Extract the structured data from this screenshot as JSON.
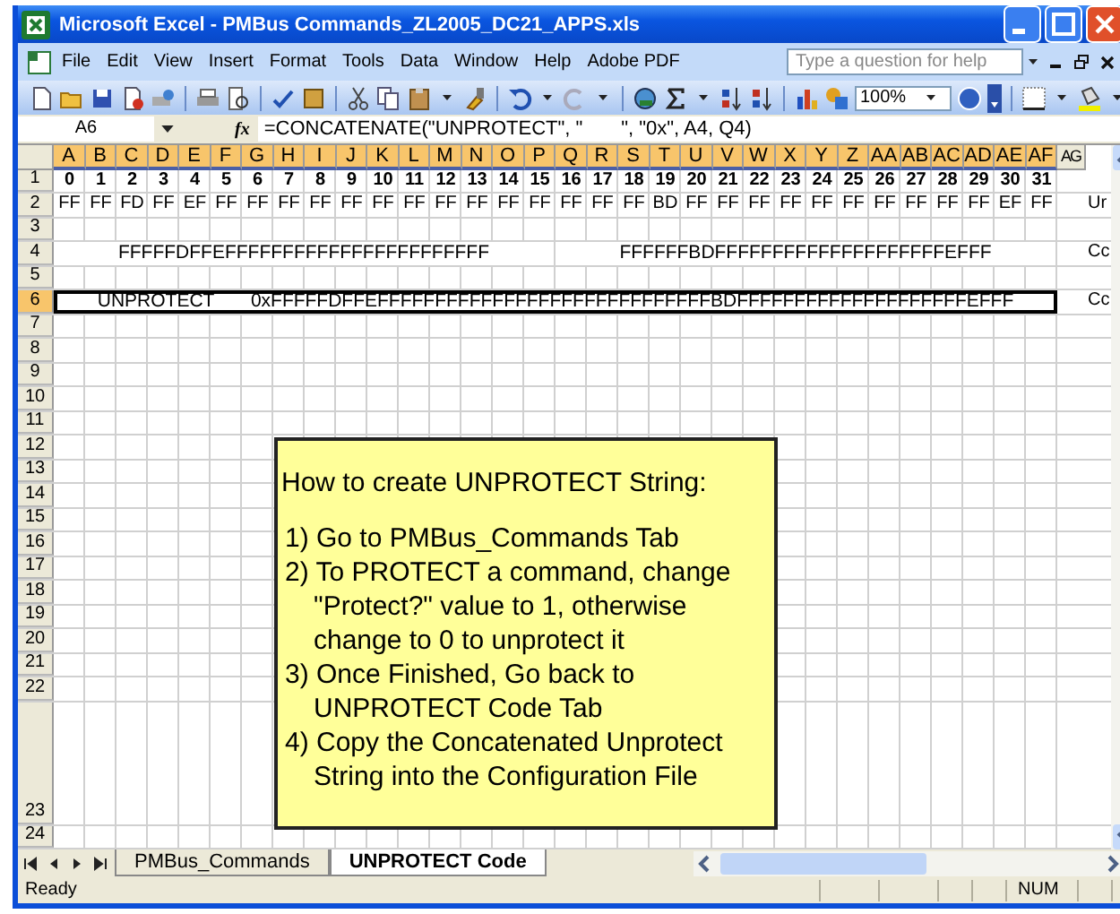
{
  "window": {
    "title": "Microsoft Excel - PMBus Commands_ZL2005_DC21_APPS.xls"
  },
  "menu": [
    "File",
    "Edit",
    "View",
    "Insert",
    "Format",
    "Tools",
    "Data",
    "Window",
    "Help",
    "Adobe PDF"
  ],
  "help_box": {
    "placeholder": "Type a question for help"
  },
  "toolbar": {
    "zoom": "100%"
  },
  "formula_bar": {
    "name_box": "A6",
    "fx": "fx",
    "formula": "=CONCATENATE(\"UNPROTECT\", \"       \", \"0x\", A4, Q4)"
  },
  "columns": [
    {
      "label": "A",
      "selected": true
    },
    {
      "label": "B",
      "selected": true
    },
    {
      "label": "C",
      "selected": true
    },
    {
      "label": "D",
      "selected": true
    },
    {
      "label": "E",
      "selected": true
    },
    {
      "label": "F",
      "selected": true
    },
    {
      "label": "G",
      "selected": true
    },
    {
      "label": "H",
      "selected": true
    },
    {
      "label": "I",
      "selected": true
    },
    {
      "label": "J",
      "selected": true
    },
    {
      "label": "K",
      "selected": true
    },
    {
      "label": "L",
      "selected": true
    },
    {
      "label": "M",
      "selected": true
    },
    {
      "label": "N",
      "selected": true
    },
    {
      "label": "O",
      "selected": true
    },
    {
      "label": "P",
      "selected": true
    },
    {
      "label": "Q",
      "selected": true
    },
    {
      "label": "R",
      "selected": true
    },
    {
      "label": "S",
      "selected": true
    },
    {
      "label": "T",
      "selected": true
    },
    {
      "label": "U",
      "selected": true
    },
    {
      "label": "V",
      "selected": true
    },
    {
      "label": "W",
      "selected": true
    },
    {
      "label": "X",
      "selected": true
    },
    {
      "label": "Y",
      "selected": true
    },
    {
      "label": "Z",
      "selected": true
    },
    {
      "label": "AA",
      "selected": true
    },
    {
      "label": "AB",
      "selected": true
    },
    {
      "label": "AC",
      "selected": true
    },
    {
      "label": "AD",
      "selected": true
    },
    {
      "label": "AE",
      "selected": true
    },
    {
      "label": "AF",
      "selected": true
    },
    {
      "label": "AG",
      "selected": false
    }
  ],
  "rows": [
    {
      "header": "1",
      "selected": false,
      "kind": "values",
      "bold": true,
      "cells": [
        "0",
        "1",
        "2",
        "3",
        "4",
        "5",
        "6",
        "7",
        "8",
        "9",
        "10",
        "11",
        "12",
        "13",
        "14",
        "15",
        "16",
        "17",
        "18",
        "19",
        "20",
        "21",
        "22",
        "23",
        "24",
        "25",
        "26",
        "27",
        "28",
        "29",
        "30",
        "31"
      ]
    },
    {
      "header": "2",
      "selected": false,
      "kind": "values",
      "bold": false,
      "cells": [
        "FF",
        "FF",
        "FD",
        "FF",
        "EF",
        "FF",
        "FF",
        "FF",
        "FF",
        "FF",
        "FF",
        "FF",
        "FF",
        "FF",
        "FF",
        "FF",
        "FF",
        "FF",
        "FF",
        "BD",
        "FF",
        "FF",
        "FF",
        "FF",
        "FF",
        "FF",
        "FF",
        "FF",
        "FF",
        "FF",
        "EF",
        "FF"
      ],
      "note": "Ur"
    },
    {
      "header": "3",
      "selected": false,
      "kind": "empty"
    },
    {
      "header": "4",
      "selected": false,
      "kind": "merged",
      "cells": [
        "FFFFFDFFEFFFFFFFFFFFFFFFFFFFFFFF",
        "FFFFFFBDFFFFFFFFFFFFFFFFFFFFEFFF"
      ],
      "note": "Cc"
    },
    {
      "header": "5",
      "selected": false,
      "kind": "empty"
    },
    {
      "header": "6",
      "selected": true,
      "kind": "merged",
      "cells": [
        "UNPROTECT       0xFFFFFDFFEFFFFFFFFFFFFFFFFFFFFFFFFFFFFFBDFFFFFFFFFFFFFFFFFFFFEFFF"
      ],
      "note": "Cc"
    },
    {
      "header": "7",
      "selected": false,
      "kind": "empty"
    },
    {
      "header": "8",
      "selected": false,
      "kind": "empty"
    },
    {
      "header": "9",
      "selected": false,
      "kind": "empty"
    },
    {
      "header": "10",
      "selected": false,
      "kind": "empty"
    },
    {
      "header": "11",
      "selected": false,
      "kind": "empty"
    },
    {
      "header": "12",
      "selected": false,
      "kind": "empty"
    },
    {
      "header": "13",
      "selected": false,
      "kind": "empty"
    },
    {
      "header": "14",
      "selected": false,
      "kind": "empty"
    },
    {
      "header": "15",
      "selected": false,
      "kind": "empty"
    },
    {
      "header": "16",
      "selected": false,
      "kind": "empty"
    },
    {
      "header": "17",
      "selected": false,
      "kind": "empty"
    },
    {
      "header": "18",
      "selected": false,
      "kind": "empty"
    },
    {
      "header": "19",
      "selected": false,
      "kind": "empty"
    },
    {
      "header": "20",
      "selected": false,
      "kind": "empty"
    },
    {
      "header": "21",
      "selected": false,
      "kind": "empty"
    },
    {
      "header": "22",
      "selected": false,
      "kind": "empty"
    },
    {
      "header": "23",
      "selected": false,
      "kind": "tall"
    },
    {
      "header": "24",
      "selected": false,
      "kind": "empty"
    }
  ],
  "note_box": {
    "title": "How to create UNPROTECT String:",
    "steps": [
      "1) Go to PMBus_Commands Tab",
      "2) To PROTECT a command, change \"Protect?\" value to 1, otherwise change to 0 to unprotect it",
      "3) Once Finished, Go back to UNPROTECT Code Tab",
      "4) Copy the Concatenated Unprotect String into the Configuration File"
    ]
  },
  "sheet_tabs": [
    {
      "label": "PMBus_Commands",
      "selected": false
    },
    {
      "label": "UNPROTECT Code",
      "selected": true
    }
  ],
  "status_bar": {
    "status": "Ready",
    "indicator": "NUM"
  }
}
